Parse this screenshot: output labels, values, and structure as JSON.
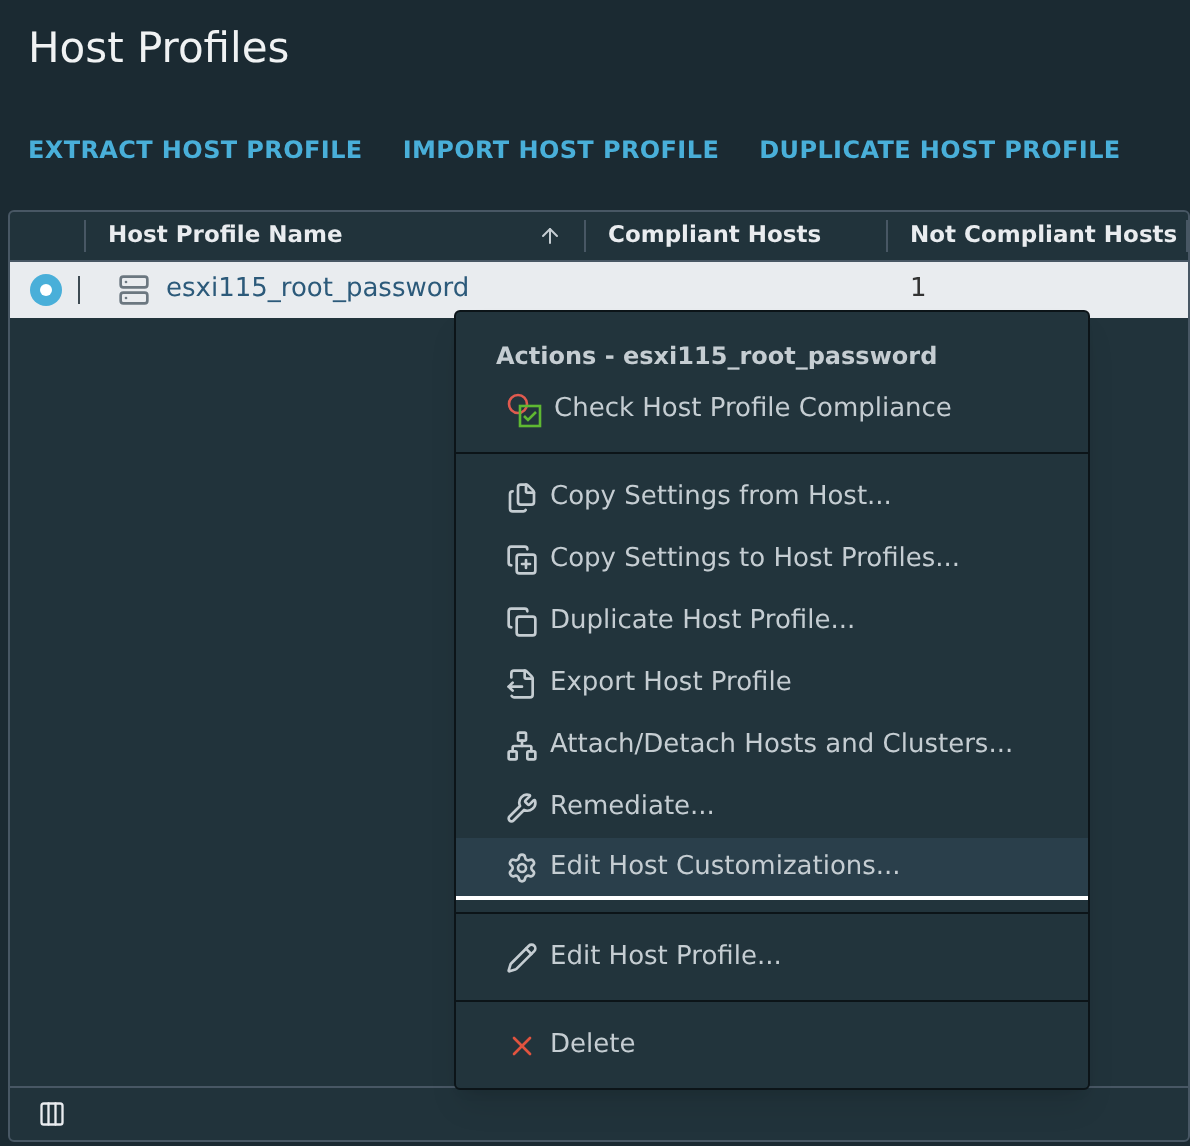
{
  "page_title": "Host Profiles",
  "actions": [
    "EXTRACT HOST PROFILE",
    "IMPORT HOST PROFILE",
    "DUPLICATE HOST PROFILE"
  ],
  "table": {
    "columns": [
      {
        "label": "Host Profile Name",
        "sorted_ascending": true
      },
      {
        "label": "Compliant Hosts"
      },
      {
        "label": "Not Compliant Hosts"
      }
    ],
    "rows": [
      {
        "selected": true,
        "name": "esxi115_root_password",
        "not_compliant_hosts": "1"
      }
    ]
  },
  "context_menu": {
    "title": "Actions - esxi115_root_password",
    "groups": [
      [
        {
          "kind": "compliance",
          "label": "Check Host Profile Compliance",
          "selected": false
        }
      ],
      [
        {
          "kind": "copy-from",
          "label": "Copy Settings from Host...",
          "selected": false
        },
        {
          "kind": "copy-to",
          "label": "Copy Settings to Host Profiles...",
          "selected": false
        },
        {
          "kind": "duplicate",
          "label": "Duplicate Host Profile...",
          "selected": false
        },
        {
          "kind": "export",
          "label": "Export Host Profile",
          "selected": false
        },
        {
          "kind": "attach",
          "label": "Attach/Detach Hosts and Clusters...",
          "selected": false
        },
        {
          "kind": "remediate",
          "label": "Remediate...",
          "selected": false
        },
        {
          "kind": "customize",
          "label": "Edit Host Customizations...",
          "selected": true
        }
      ],
      [
        {
          "kind": "edit",
          "label": "Edit Host Profile...",
          "selected": false
        }
      ],
      [
        {
          "kind": "delete",
          "label": "Delete",
          "selected": false
        }
      ]
    ]
  }
}
